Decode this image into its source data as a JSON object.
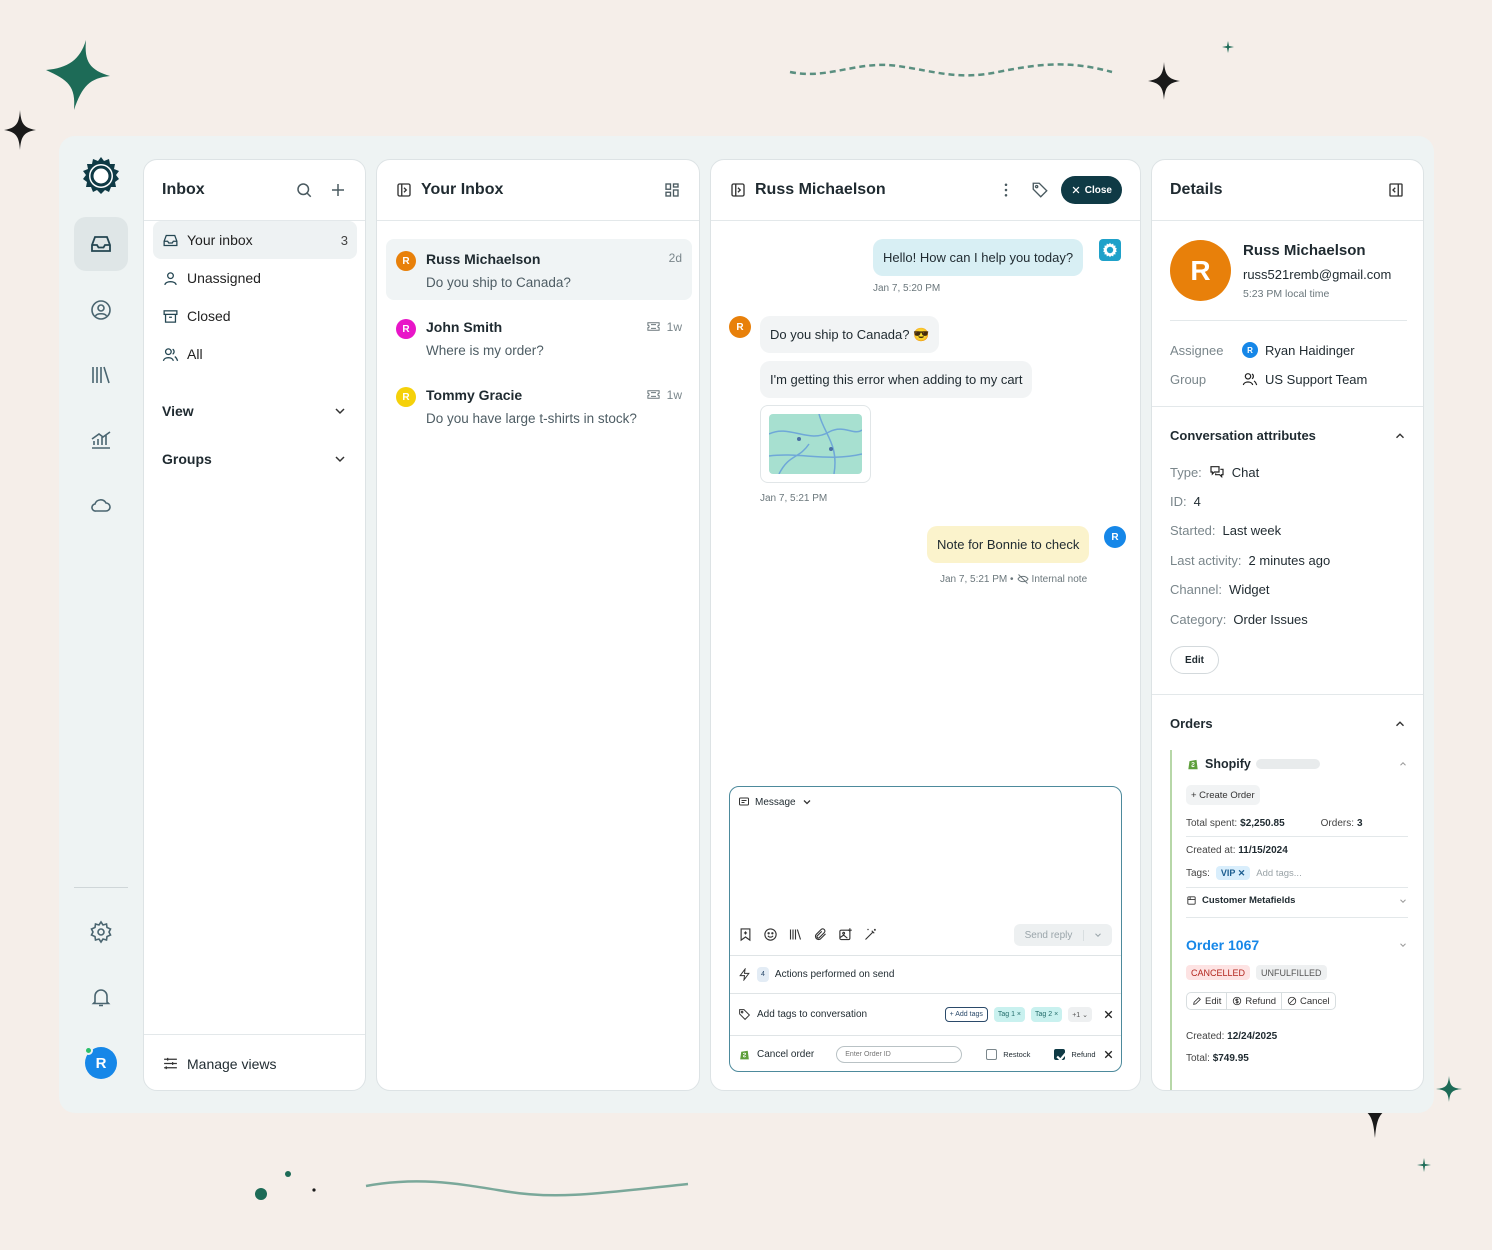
{
  "colors": {
    "background": "#f5eee9",
    "primary_dark": "#0f3a45",
    "accent_green": "#1d6b57",
    "brand_blue": "#1687e8"
  },
  "rail": {
    "icons": [
      "logo-icon",
      "inbox-icon",
      "user-circle-icon",
      "library-icon",
      "chart-icon",
      "cloud-icon",
      "settings-icon",
      "bell-icon"
    ],
    "avatar_initial": "R"
  },
  "inbox_nav": {
    "title": "Inbox",
    "items": [
      {
        "label": "Your inbox",
        "count": "3"
      },
      {
        "label": "Unassigned"
      },
      {
        "label": "Closed"
      },
      {
        "label": "All"
      }
    ],
    "view_label": "View",
    "groups_label": "Groups",
    "manage_views": "Manage views"
  },
  "conversation_list": {
    "title": "Your Inbox",
    "conversations": [
      {
        "initial": "R",
        "name": "Russ Michaelson",
        "snippet": "Do you ship to Canada?",
        "time": "2d",
        "avatar_color": "#e8800a"
      },
      {
        "initial": "R",
        "name": "John Smith",
        "snippet": "Where is my order?",
        "time": "1w",
        "avatar_color": "#e815c8"
      },
      {
        "initial": "R",
        "name": "Tommy Gracie",
        "snippet": "Do you have large t-shirts in stock?",
        "time": "1w",
        "avatar_color": "#f5d10a"
      }
    ]
  },
  "chat": {
    "title": "Russ Michaelson",
    "close_label": "Close",
    "messages": [
      {
        "text": "Hello! How can I help you today?",
        "meta": "Jan 7, 5:20 PM"
      },
      {
        "text": "Do you ship to Canada? 😎"
      },
      {
        "text": "I'm getting this error when adding to my cart",
        "meta": "Jan 7, 5:21 PM"
      },
      {
        "text": "Note for Bonnie to check",
        "meta": "Jan 7, 5:21 PM •",
        "note_label": "Internal note"
      }
    ],
    "customer_initial": "R",
    "agent_initial": "R",
    "composer": {
      "mode_label": "Message",
      "send_label": "Send reply",
      "actions_count": "4",
      "actions_label": "Actions performed on send",
      "tags_label": "Add tags to conversation",
      "add_tags_btn": "+ Add tags",
      "tags": [
        "Tag 1 ×",
        "Tag 2 ×"
      ],
      "more_tags": "+1 ⌄",
      "cancel_label": "Cancel order",
      "order_placeholder": "Enter Order ID",
      "restock_label": "Restock",
      "refund_label": "Refund"
    }
  },
  "details": {
    "title": "Details",
    "contact": {
      "initial": "R",
      "name": "Russ Michaelson",
      "email": "russ521remb@gmail.com",
      "local_time": "5:23 PM local time"
    },
    "assignee_label": "Assignee",
    "assignee_initial": "R",
    "assignee": "Ryan Haidinger",
    "group_label": "Group",
    "group": "US Support Team",
    "attributes_title": "Conversation attributes",
    "attributes": [
      {
        "label": "Type:",
        "value": "Chat"
      },
      {
        "label": "ID:",
        "value": "4"
      },
      {
        "label": "Started:",
        "value": "Last week"
      },
      {
        "label": "Last activity:",
        "value": "2 minutes ago"
      },
      {
        "label": "Channel:",
        "value": "Widget"
      },
      {
        "label": "Category:",
        "value": "Order Issues"
      }
    ],
    "edit_label": "Edit",
    "orders_title": "Orders",
    "shopify": {
      "name": "Shopify",
      "create_order": "+ Create Order",
      "total_spent_label": "Total spent:",
      "total_spent": "$2,250.85",
      "orders_label": "Orders:",
      "orders_count": "3",
      "created_label": "Created at:",
      "created": "11/15/2024",
      "tags_label": "Tags:",
      "tag": "VIP ✕",
      "add_tags_placeholder": "Add tags...",
      "metafields": "Customer Metafields"
    },
    "order": {
      "title": "Order 1067",
      "badges": [
        "CANCELLED",
        "UNFULFILLED"
      ],
      "actions": [
        "Edit",
        "Refund",
        "Cancel"
      ],
      "created_label": "Created:",
      "created": "12/24/2025",
      "total_label": "Total:",
      "total": "$749.95"
    }
  }
}
